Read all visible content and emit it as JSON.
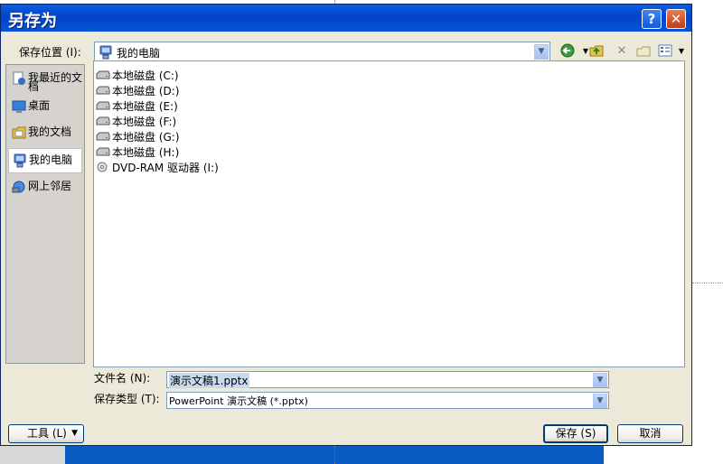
{
  "dialog": {
    "title": "另存为",
    "help_icon": "question-mark-icon",
    "close_icon": "close-x-icon"
  },
  "save_in": {
    "label": "保存位置 (I):",
    "value": "我的电脑",
    "icon": "computer-icon"
  },
  "toolbar": {
    "back_icon": "back-arrow-icon",
    "up_icon": "up-folder-icon",
    "delete_icon": "delete-x-icon",
    "new_folder_icon": "new-folder-icon",
    "views_icon": "views-menu-icon"
  },
  "places": [
    {
      "label_line1": "我最近的文",
      "label_line2": "档",
      "icon": "recent-documents-icon"
    },
    {
      "label_line1": "桌面",
      "label_line2": "",
      "icon": "desktop-icon"
    },
    {
      "label_line1": "我的文档",
      "label_line2": "",
      "icon": "my-documents-icon"
    },
    {
      "label_line1": "我的电脑",
      "label_line2": "",
      "icon": "computer-icon",
      "selected": true
    },
    {
      "label_line1": "网上邻居",
      "label_line2": "",
      "icon": "network-places-icon"
    }
  ],
  "files": [
    {
      "name": "本地磁盘 (C:)",
      "icon": "hard-drive-icon"
    },
    {
      "name": "本地磁盘 (D:)",
      "icon": "hard-drive-icon"
    },
    {
      "name": "本地磁盘 (E:)",
      "icon": "hard-drive-icon"
    },
    {
      "name": "本地磁盘 (F:)",
      "icon": "hard-drive-icon"
    },
    {
      "name": "本地磁盘 (G:)",
      "icon": "hard-drive-icon"
    },
    {
      "name": "本地磁盘 (H:)",
      "icon": "hard-drive-icon"
    },
    {
      "name": "DVD-RAM 驱动器 (I:)",
      "icon": "dvd-drive-icon"
    }
  ],
  "file_name": {
    "label": "文件名 (N):",
    "value": "演示文稿1.pptx"
  },
  "file_type": {
    "label": "保存类型 (T):",
    "value": "PowerPoint 演示文稿 (*.pptx)"
  },
  "buttons": {
    "tools": "工具 (L)",
    "save": "保存 (S)",
    "cancel": "取消"
  },
  "colors": {
    "titlebar": "#0343c9",
    "dialog_bg": "#ece9d8",
    "selection": "#c7daf0"
  }
}
